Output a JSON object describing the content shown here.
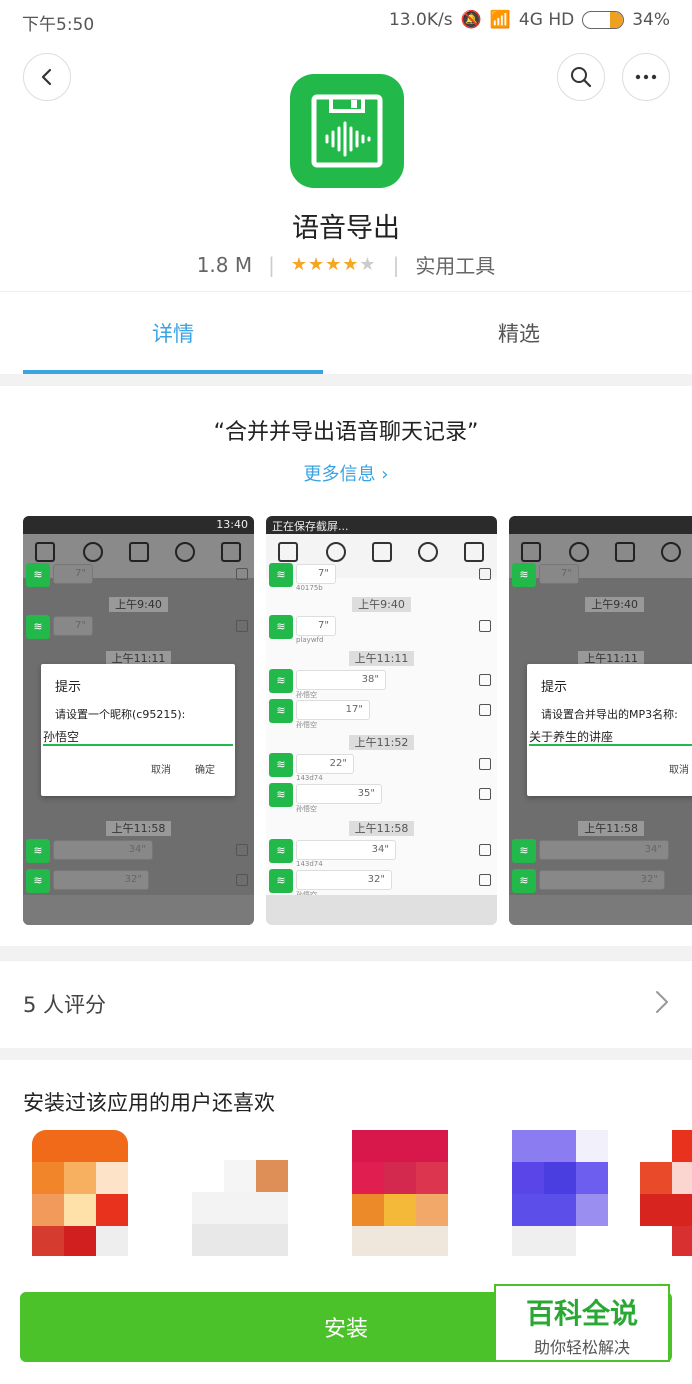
{
  "status_bar": {
    "time": "下午5:50",
    "speed": "13.0K/s",
    "network": "4G HD",
    "battery": "34%",
    "battery_level": 0.34
  },
  "app": {
    "name": "语音导出",
    "size": "1.8 M",
    "rating": 4,
    "rating_max": 5,
    "category": "实用工具",
    "icon_color": "#22b94a"
  },
  "tabs": [
    {
      "label": "详情",
      "active": true
    },
    {
      "label": "精选",
      "active": false
    }
  ],
  "detail": {
    "tagline": "“合并并导出语音聊天记录”",
    "more_info": "更多信息 ›"
  },
  "screenshots": [
    {
      "status_time": "13:40",
      "times": [
        "上午9:40",
        "上午11:11",
        "上午11:58"
      ],
      "dialog": {
        "title": "提示",
        "message": "请设置一个昵称(c95215):",
        "input": "孙悟空",
        "cancel": "取消",
        "ok": "确定"
      },
      "durations": [
        "7\"",
        "7\"",
        "34\"",
        "32\""
      ]
    },
    {
      "status_text": "正在保存截屏...",
      "times": [
        "上午9:40",
        "上午11:11",
        "上午11:52",
        "上午11:58"
      ],
      "durations": [
        "7\"",
        "7\"",
        "38\"",
        "17\"",
        "22\"",
        "35\"",
        "34\"",
        "32\""
      ],
      "subs": [
        "40175b",
        "playwfd",
        "孙悟空",
        "孙悟空",
        "143d74",
        "孙悟空",
        "143d74",
        "孙悟空"
      ]
    },
    {
      "times": [
        "上午9:40",
        "上午11:11",
        "上午11:58"
      ],
      "dialog": {
        "title": "提示",
        "message": "请设置合并导出的MP3名称:",
        "input": "关于养生的讲座",
        "cancel": "取消"
      },
      "durations": [
        "7\"",
        "34\"",
        "32\""
      ]
    }
  ],
  "ratings": {
    "label": "5 人评分"
  },
  "also_liked": {
    "title": "安装过该应用的用户还喜欢"
  },
  "install": {
    "label": "安装",
    "color": "#4cc22a"
  },
  "watermark": {
    "main": "百科全说",
    "sub": "助你轻松解决"
  }
}
